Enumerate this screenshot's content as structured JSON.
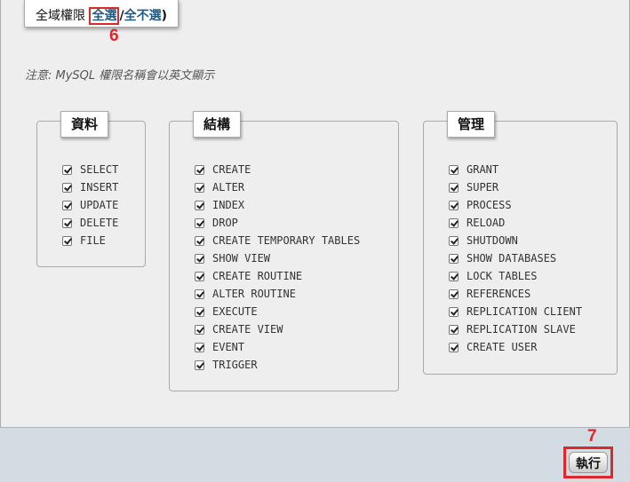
{
  "legend": {
    "title": "全域權限",
    "select_all": "全選",
    "separator": "/",
    "deselect_all": "全不選",
    "close_paren": ")"
  },
  "markers": {
    "step6": "6",
    "step7": "7"
  },
  "note": "注意: MySQL 權限名稱會以英文顯示",
  "groups": [
    {
      "title": "資料",
      "items": [
        "SELECT",
        "INSERT",
        "UPDATE",
        "DELETE",
        "FILE"
      ]
    },
    {
      "title": "結構",
      "items": [
        "CREATE",
        "ALTER",
        "INDEX",
        "DROP",
        "CREATE TEMPORARY TABLES",
        "SHOW VIEW",
        "CREATE ROUTINE",
        "ALTER ROUTINE",
        "EXECUTE",
        "CREATE VIEW",
        "EVENT",
        "TRIGGER"
      ]
    },
    {
      "title": "管理",
      "items": [
        "GRANT",
        "SUPER",
        "PROCESS",
        "RELOAD",
        "SHUTDOWN",
        "SHOW DATABASES",
        "LOCK TABLES",
        "REFERENCES",
        "REPLICATION CLIENT",
        "REPLICATION SLAVE",
        "CREATE USER"
      ]
    }
  ],
  "checked": true,
  "footer": {
    "go_label": "執行"
  },
  "colors": {
    "highlight": "#d9282e",
    "link": "#235a81",
    "panel": "#eeeeee",
    "footer": "#d4dce3"
  }
}
